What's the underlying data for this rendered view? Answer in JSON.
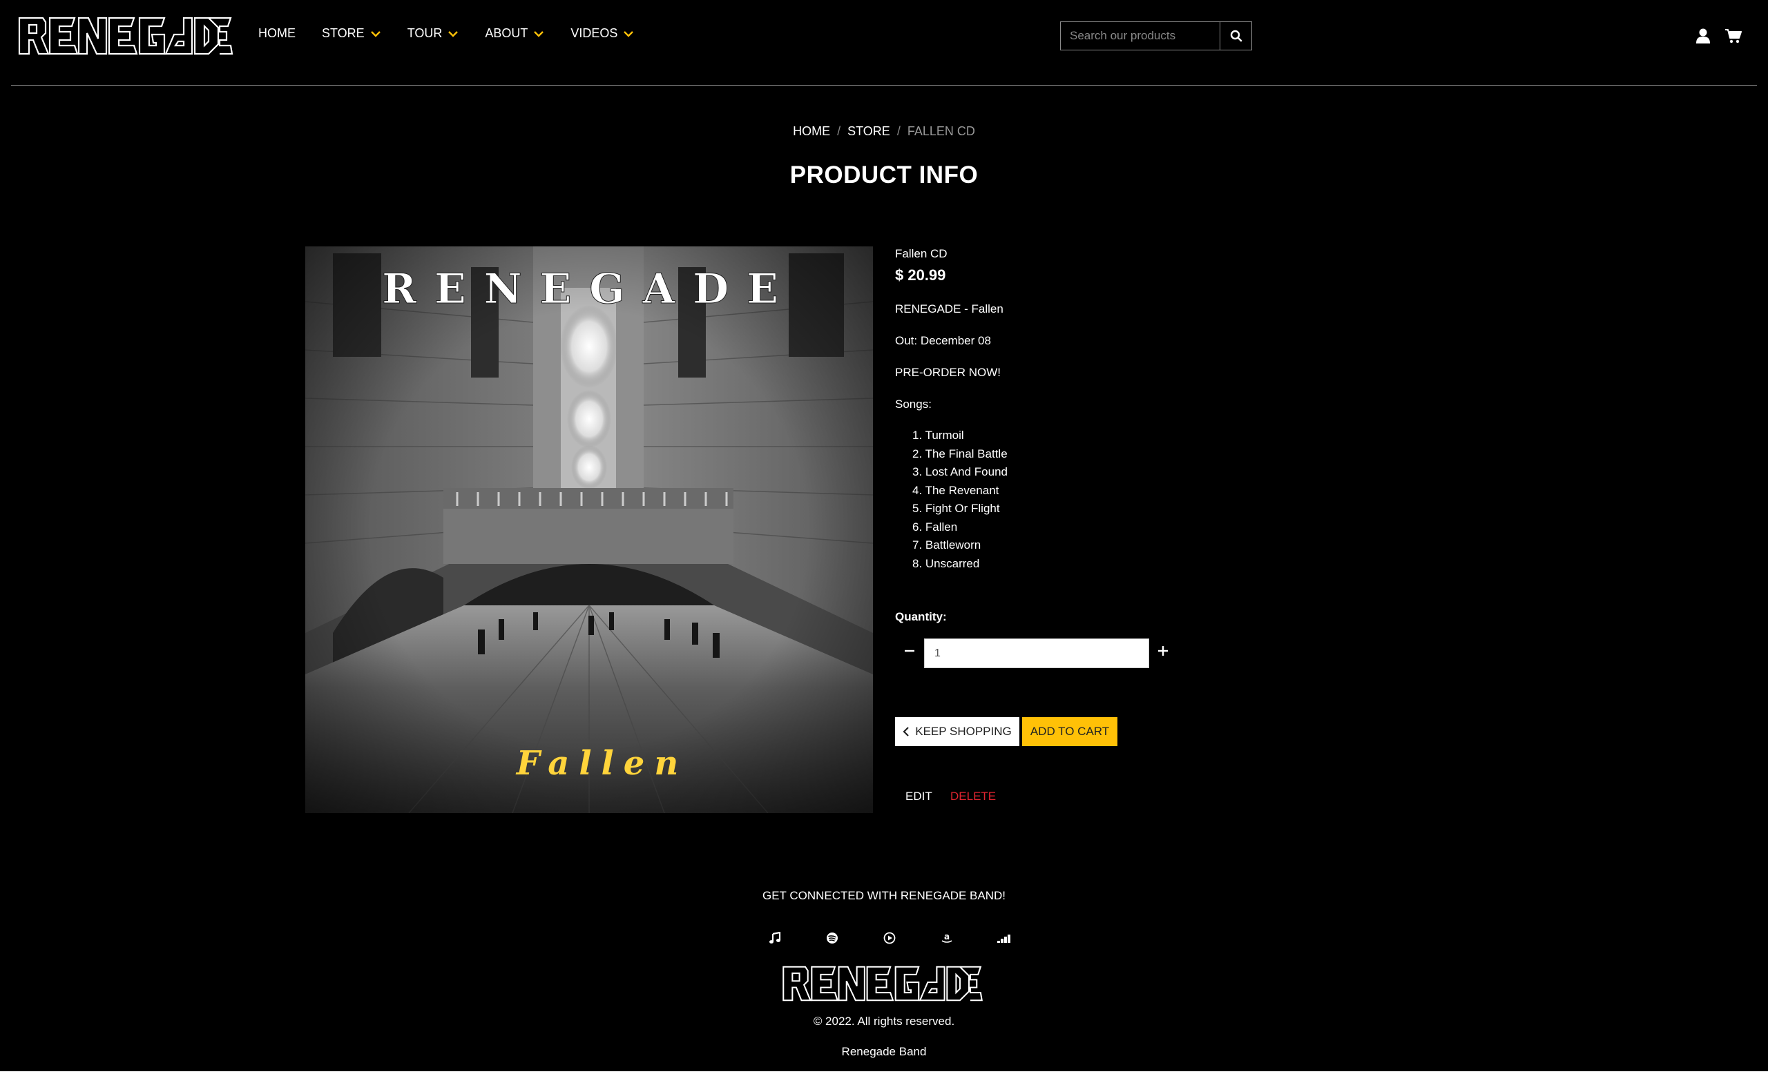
{
  "brand": {
    "logo_text": "RENEGADE"
  },
  "nav": {
    "items": [
      {
        "label": "HOME",
        "dropdown": false
      },
      {
        "label": "STORE",
        "dropdown": true
      },
      {
        "label": "TOUR",
        "dropdown": true
      },
      {
        "label": "ABOUT",
        "dropdown": true
      },
      {
        "label": "VIDEOS",
        "dropdown": true
      }
    ],
    "search_placeholder": "Search our products",
    "accent_color": "#ffc107"
  },
  "breadcrumb": {
    "home": "HOME",
    "store": "STORE",
    "current": "FALLEN CD",
    "separator": "/"
  },
  "page_title": "PRODUCT INFO",
  "cover": {
    "band_text": "RENEGADE",
    "album_text": "Fallen"
  },
  "product": {
    "name": "Fallen CD",
    "price": "$ 20.99",
    "subtitle": "RENEGADE - Fallen",
    "release": "Out: December 08",
    "preorder": "PRE-ORDER NOW!",
    "songs_label": "Songs:",
    "songs": [
      "1. Turmoil",
      "2. The Final Battle",
      "3. Lost And Found",
      "4. The Revenant",
      "5. Fight Or Flight",
      "6. Fallen",
      "7. Battleworn",
      "8. Unscarred"
    ]
  },
  "quantity": {
    "label": "Quantity:",
    "value": "1"
  },
  "buttons": {
    "keep_shopping": "KEEP SHOPPING",
    "add_to_cart": "ADD TO CART",
    "edit": "EDIT",
    "delete": "DELETE"
  },
  "footer": {
    "heading": "GET CONNECTED WITH RENEGADE BAND!",
    "socials": [
      "itunes-icon",
      "spotify-icon",
      "youtube-music-icon",
      "amazon-icon",
      "deezer-icon"
    ],
    "copyright": "© 2022. All rights reserved.",
    "band_name": "Renegade Band"
  }
}
